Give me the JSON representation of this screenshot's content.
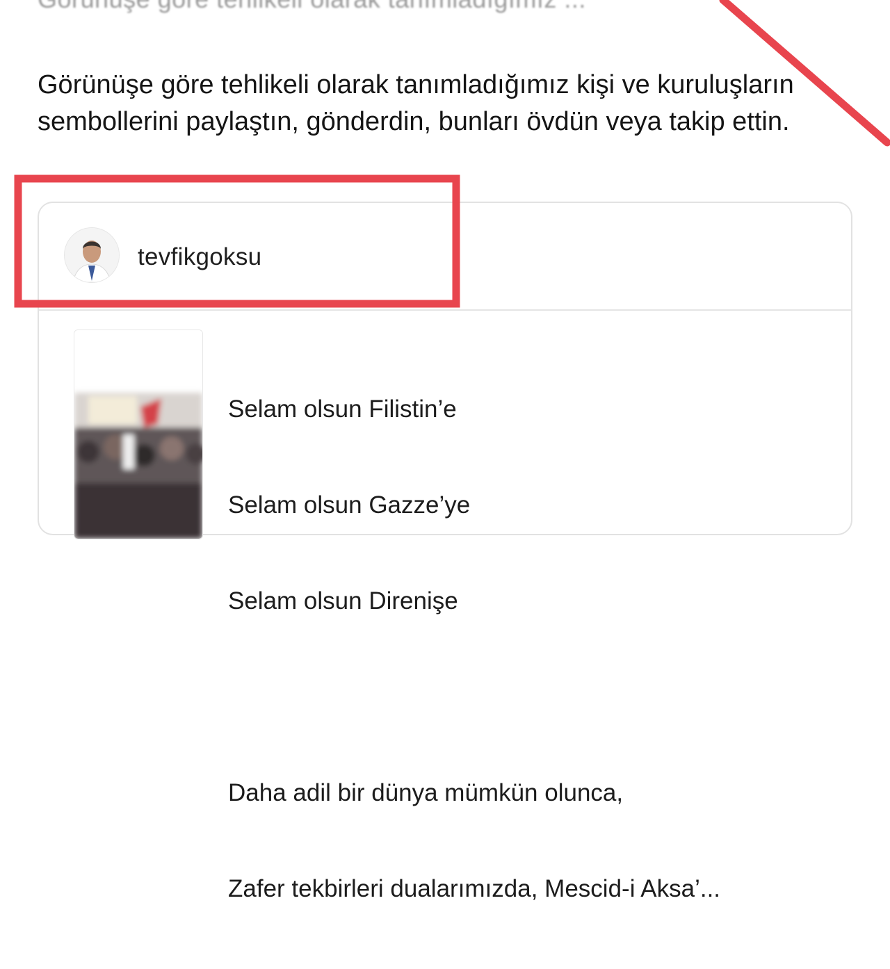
{
  "top_text": "Görünüşe göre tehlikeli olarak tanımladığımız ...",
  "warning_text": "Görünüşe göre tehlikeli olarak tanımladığımız kişi ve kuruluşların sembollerini paylaştın, gönderdin, bunları övdün veya takip ettin.",
  "post": {
    "username": "tevfikgoksu",
    "lines": [
      "Selam olsun Filistin’e",
      "Selam olsun Gazze’ye",
      "Selam olsun Direnişe",
      "",
      "Daha adil bir dünya mümkün olunca,",
      "Zafer tekbirleri dualarımızda, Mescid-i Aksa’..."
    ]
  },
  "annotation": {
    "color": "#e8454e"
  }
}
